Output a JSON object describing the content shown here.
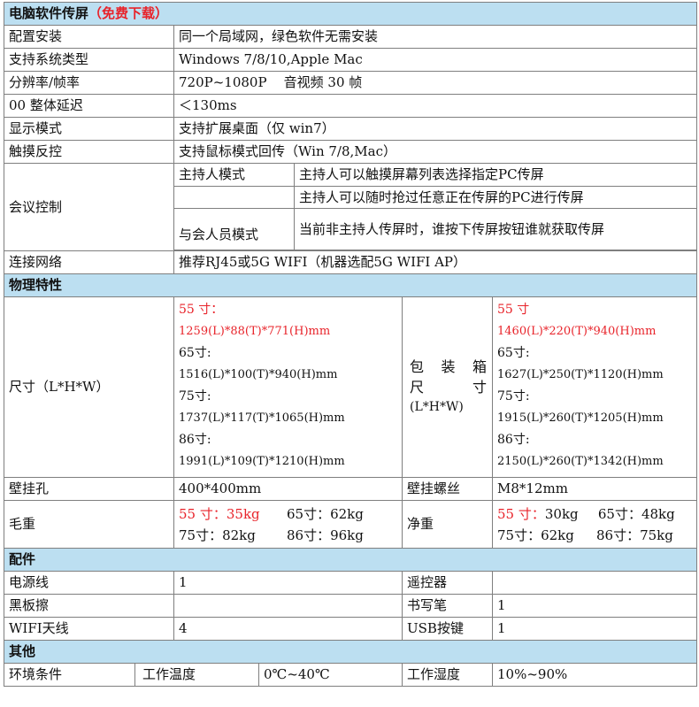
{
  "software": {
    "title": "电脑软件传屏",
    "title_note": "（免费下载）",
    "rows": [
      {
        "label": "配置安装",
        "value": "同一个局域网，绿色软件无需安装"
      },
      {
        "label": "支持系统类型",
        "value": "Windows 7/8/10,Apple Mac"
      },
      {
        "label": "分辨率/帧率",
        "value": "720P~1080P    音视频 30 帧"
      },
      {
        "label": "00 整体延迟",
        "value": "＜130ms"
      },
      {
        "label": "显示模式",
        "value": "支持扩展桌面（仅 win7）"
      },
      {
        "label": "触摸反控",
        "value": "支持鼠标模式回传（Win 7/8,Mac）"
      }
    ],
    "meeting": {
      "label": "会议控制",
      "host_mode": "主持人模式",
      "host_desc_1": "主持人可以触摸屏幕列表选择指定PC传屏",
      "host_desc_2": "主持人可以随时抢过任意正在传屏的PC进行传屏",
      "participant_mode": "与会人员模式",
      "participant_desc": "当前非主持人传屏时，谁按下传屏按钮谁就获取传屏"
    },
    "network": {
      "label": "连接网络",
      "value": "推荐RJ45或5G WIFI（机器选配5G WIFI AP）"
    }
  },
  "physical": {
    "title": "物理特性",
    "size_label": "尺寸（L*H*W）",
    "sizes": [
      {
        "name": "55 寸：",
        "dims": "1259(L)*88(T)*771(H)mm"
      },
      {
        "name": "65寸:",
        "dims": "1516(L)*100(T)*940(H)mm"
      },
      {
        "name": "75寸:",
        "dims": "1737(L)*117(T)*1065(H)mm"
      },
      {
        "name": "86寸:",
        "dims": "1991(L)*109(T)*1210(H)mm"
      }
    ],
    "package_label_1a": "包",
    "package_label_1b": "装",
    "package_label_1c": "箱",
    "package_label_2a": "尺",
    "package_label_2b": "寸",
    "package_label_3": "(L*H*W)",
    "package_sizes": [
      {
        "name": "55 寸",
        "dims": "1460(L)*220(T)*940(H)mm"
      },
      {
        "name": "65寸:",
        "dims": "1627(L)*250(T)*1120(H)mm"
      },
      {
        "name": "75寸:",
        "dims": "1915(L)*260(T)*1205(H)mm"
      },
      {
        "name": "86寸:",
        "dims": "2150(L)*260(T)*1342(H)mm"
      }
    ],
    "mount_hole_label": "壁挂孔",
    "mount_hole_value": "400*400mm",
    "mount_screw_label": "壁挂螺丝",
    "mount_screw_value": "M8*12mm",
    "gross_label": "毛重",
    "gross_55": "55 寸：35kg",
    "gross_65": "65寸：62kg",
    "gross_75": "75寸：82kg",
    "gross_86": "86寸：96kg",
    "net_label": "净重",
    "net_55": "55 寸：",
    "net_55_val": "30kg",
    "net_65": "65寸：48kg",
    "net_75": "75寸：62kg",
    "net_86": "86寸：75kg"
  },
  "accessories": {
    "title": "配件",
    "rows": [
      {
        "l1": "电源线",
        "v1": "1",
        "l2": "遥控器",
        "v2": ""
      },
      {
        "l1": "黑板擦",
        "v1": "",
        "l2": "书写笔",
        "v2": "1"
      },
      {
        "l1": "WIFI天线",
        "v1": "4",
        "l2": "USB按键",
        "v2": "1"
      }
    ]
  },
  "other": {
    "title": "其他",
    "env_label": "环境条件",
    "temp_label": "工作温度",
    "temp_value": "0℃~40℃",
    "humidity_label": "工作湿度",
    "humidity_value": "10%~90%"
  }
}
